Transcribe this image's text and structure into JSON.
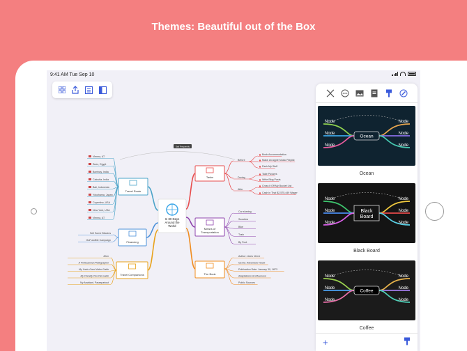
{
  "headline": "Themes: Beautiful out of the Box",
  "status": {
    "time": "9:41 AM  Tue Sep 10"
  },
  "toolbar": {
    "buttons": [
      "grid-icon",
      "share-icon",
      "outline-icon",
      "sidebar-icon"
    ]
  },
  "mindmap": {
    "central": [
      "In 80 Days",
      "Around the",
      "World"
    ],
    "relationship_label": "Sail Frequently",
    "branches": {
      "tasks": {
        "label": "Tasks",
        "sub": [
          "Before",
          "During",
          "After"
        ],
        "items": [
          "Book Accommodation",
          "Make an Apple Music Playlist",
          "Pack My Stuff",
          "Take Pictures",
          "Write Blog Posts",
          "Cross it Off My Bucket List",
          "Cash in That $2,575,449 Wager"
        ]
      },
      "travel": {
        "label": "Travel Route",
        "items": [
          "Vienna, AT",
          "Suez, Egypt",
          "Bombay, India",
          "Calcutta, India",
          "Bali, Indonesia",
          "Yokohama, Japan",
          "Cupertino, USA",
          "New York, USA",
          "Vienna, AT"
        ]
      },
      "transport": {
        "label": [
          "Means of",
          "Transportation"
        ],
        "items": [
          "Car sharing",
          "Scooters",
          "Bike",
          "Train",
          "By Foot"
        ]
      },
      "financing": {
        "label": "Financing",
        "items": [
          "Sell Some Bitcoins",
          "GoFundMe Campaign"
        ]
      },
      "book": {
        "label": "The Book",
        "items": [
          "Author: Jules Verne",
          "Genre: Adventure Novel",
          "Publication Date: January 30, 1873",
          "Adaptations & Influences",
          "Public Sources"
        ]
      },
      "companions": {
        "label": "Travel Companions",
        "items": [
          "Mom",
          "A Professional Photographer",
          "My Youtu-Gami Video Guide",
          "My Friendly Pen-Pal Guide",
          "My Assistant, Passepartout"
        ]
      }
    }
  },
  "themes": [
    {
      "name": "Ocean",
      "center": "Ocean",
      "node_label": "Node",
      "bg": "#0f2330",
      "center_bg": "#0f2330",
      "line_colors": [
        "#8fd14f",
        "#3da7e8",
        "#e75b9c",
        "#e7a64f",
        "#8a6fe8",
        "#46c7b0"
      ]
    },
    {
      "name": "Black Board",
      "center": "Black Board",
      "node_label": "Node",
      "bg": "#141414",
      "center_bg": "#141414",
      "line_colors": [
        "#3ec46d",
        "#4a8cf0",
        "#d95fe8",
        "#f0c93e",
        "#e64a4a",
        "#5ad0e6"
      ]
    },
    {
      "name": "Coffee",
      "center": "Coffee",
      "node_label": "Node",
      "bg": "#1b1b1b",
      "center_bg": "#000000",
      "line_colors": [
        "#9ad14f",
        "#4aa0f0",
        "#e86fa8",
        "#e8b34a",
        "#a07be8",
        "#4fd0b8"
      ]
    }
  ],
  "panel": {
    "tabs": [
      "style-icon",
      "more-icon",
      "image-icon",
      "note-icon",
      "brush-icon",
      "compass-icon"
    ],
    "add_label": "+",
    "format_icon": "format-brush-icon"
  },
  "colors": {
    "background": "#f47f80",
    "accent": "#3b5bdb",
    "tasks": "#e84c4c",
    "travel": "#4aa3c8",
    "transport": "#8e44ad",
    "financing": "#4a90d9",
    "book": "#f08c1e",
    "companions": "#e8a21a"
  }
}
